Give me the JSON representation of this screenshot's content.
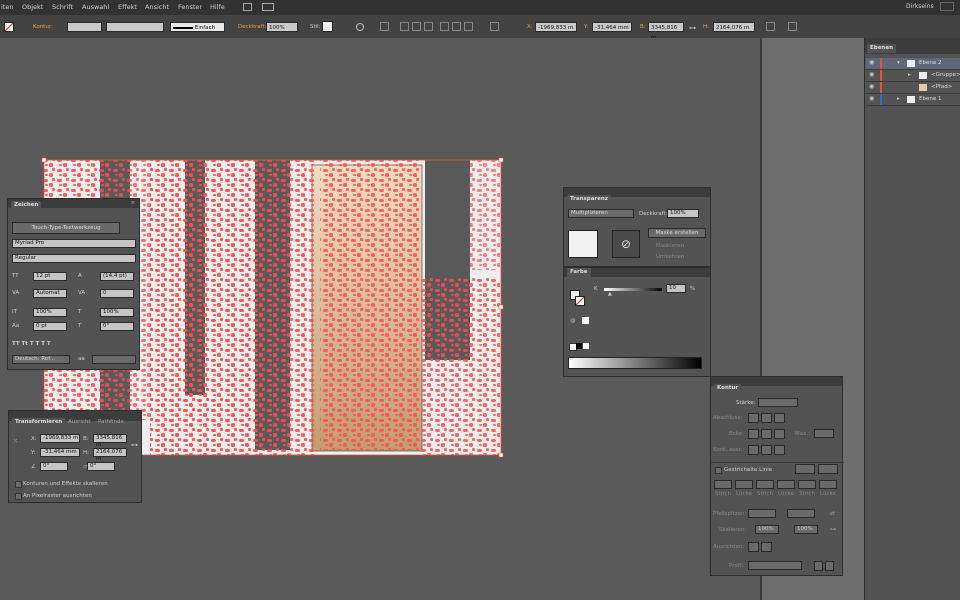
{
  "menu": [
    "iten",
    "Objekt",
    "Schrift",
    "Auswahl",
    "Effekt",
    "Ansicht",
    "Fenster",
    "Hilfe"
  ],
  "workspace": "Dirkseins",
  "control": {
    "kontur_label": "Kontur:",
    "stroke_style": "Einfach",
    "deckkraft_label": "Deckkraft:",
    "deckkraft_value": "100%",
    "stil_label": "Stil:",
    "x_label": "X:",
    "x_value": "-1969,833 m",
    "y_label": "Y:",
    "y_value": "-31,464 mm",
    "b_label": "B:",
    "b_value": "3345,816 m",
    "h_label": "H:",
    "h_value": "2164,076 m"
  },
  "layers_panel": {
    "title": "Ebenen",
    "rows": [
      {
        "name": "Ebene 2",
        "color": "#e0553a",
        "selected": true
      },
      {
        "name": "<Gruppe>",
        "color": "#e0553a",
        "selected": false
      },
      {
        "name": "<Pfad>",
        "color": "#e0553a",
        "selected": false
      },
      {
        "name": "Ebene 1",
        "color": "#3a66e0",
        "selected": false
      }
    ]
  },
  "zeichen_panel": {
    "title": "Zeichen",
    "tool_button": "Touch-Type-Textwerkzeug",
    "font": "Myriad Pro",
    "style": "Regular",
    "size": "12 pt",
    "leading": "(14,4 pt)",
    "kerning": "Automat",
    "tracking": "0",
    "vscale": "100%",
    "hscale": "100%",
    "baseline": "0 pt",
    "rotation": "0°",
    "language": "Deutsch: Ref..."
  },
  "transform_panel": {
    "tabs": [
      "Transformieren",
      "Ausricht",
      "Pathfinde"
    ],
    "x_label": "X:",
    "x_value": "-1969,833 m",
    "y_label": "Y:",
    "y_value": "-31,464 mm",
    "b_label": "B:",
    "b_value": "3345,816 m",
    "h_label": "H:",
    "h_value": "2164,076 m",
    "angle1": "0°",
    "angle2": "0°",
    "check1": "Konturen und Effekte skalieren",
    "check2": "An Pixelraster ausrichten"
  },
  "transparenz_panel": {
    "title": "Transparenz",
    "mode": "Multiplizieren",
    "deckkraft_label": "Deckkraft:",
    "deckkraft_value": "100%",
    "mask_button": "Maske erstellen",
    "clip": "Maskieren",
    "invert": "Umkehren"
  },
  "farbe_panel": {
    "title": "Farbe",
    "channel": "K",
    "value": "10",
    "unit": "%"
  },
  "kontur_panel": {
    "title": "Kontur",
    "staerke_label": "Stärke:",
    "abschluss_label": "Abschluss:",
    "ecke_label": "Ecke:",
    "max_label": "Max.:",
    "kont_label": "Kont. ausr.:",
    "dashed_label": "Gestrichelte Linie",
    "dash_labels": [
      "Strich",
      "Lücke",
      "Strich",
      "Lücke",
      "Strich",
      "Lücke"
    ],
    "pfeil_label": "Pfeilspitzen:",
    "skalieren_label": "Skalieren:",
    "scale1": "100%",
    "scale2": "100%",
    "ausrichten_label": "Ausrichten:",
    "profil_label": "Profil:"
  },
  "colors": {
    "selection": "#e0553a",
    "splatter": "#ff4d4d",
    "accent_orange": "#f29e3d"
  }
}
